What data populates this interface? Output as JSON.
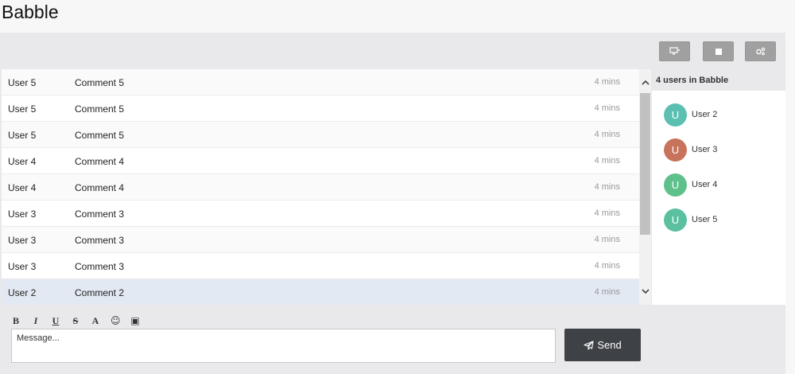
{
  "app": {
    "title": "Babble"
  },
  "toolbar": {
    "buttons": [
      {
        "icon": "monitor-arrows-icon"
      },
      {
        "icon": "stop-square-icon"
      },
      {
        "icon": "settings-gears-icon"
      }
    ]
  },
  "messages": [
    {
      "user": "User 5",
      "text": "Comment 5",
      "time": "4 mins"
    },
    {
      "user": "User 5",
      "text": "Comment 5",
      "time": "4 mins"
    },
    {
      "user": "User 5",
      "text": "Comment 5",
      "time": "4 mins"
    },
    {
      "user": "User 4",
      "text": "Comment 4",
      "time": "4 mins"
    },
    {
      "user": "User 4",
      "text": "Comment 4",
      "time": "4 mins"
    },
    {
      "user": "User 3",
      "text": "Comment 3",
      "time": "4 mins"
    },
    {
      "user": "User 3",
      "text": "Comment 3",
      "time": "4 mins"
    },
    {
      "user": "User 3",
      "text": "Comment 3",
      "time": "4 mins"
    },
    {
      "user": "User 2",
      "text": "Comment 2",
      "time": "4 mins",
      "selected": true
    }
  ],
  "users_panel": {
    "header": "4 users in Babble",
    "users": [
      {
        "initial": "U",
        "name": "User 2",
        "color": "#5bc0b2"
      },
      {
        "initial": "U",
        "name": "User 3",
        "color": "#c8735c"
      },
      {
        "initial": "U",
        "name": "User 4",
        "color": "#5ec08a"
      },
      {
        "initial": "U",
        "name": "User 5",
        "color": "#5bc0a0"
      }
    ]
  },
  "composer": {
    "format_buttons": [
      {
        "label": "B",
        "name": "bold"
      },
      {
        "label": "I",
        "name": "italic"
      },
      {
        "label": "U",
        "name": "underline"
      },
      {
        "label": "S",
        "name": "strikethrough"
      },
      {
        "label": "A",
        "name": "font-color"
      },
      {
        "label": "☺",
        "name": "emoji"
      },
      {
        "label": "▣",
        "name": "embed"
      }
    ],
    "placeholder": "Message...",
    "send_label": "Send"
  },
  "colors": {
    "send_bg": "#3e4146",
    "toolbar_button": "#a0a0a0",
    "selected_row": "#e2e9f3"
  }
}
